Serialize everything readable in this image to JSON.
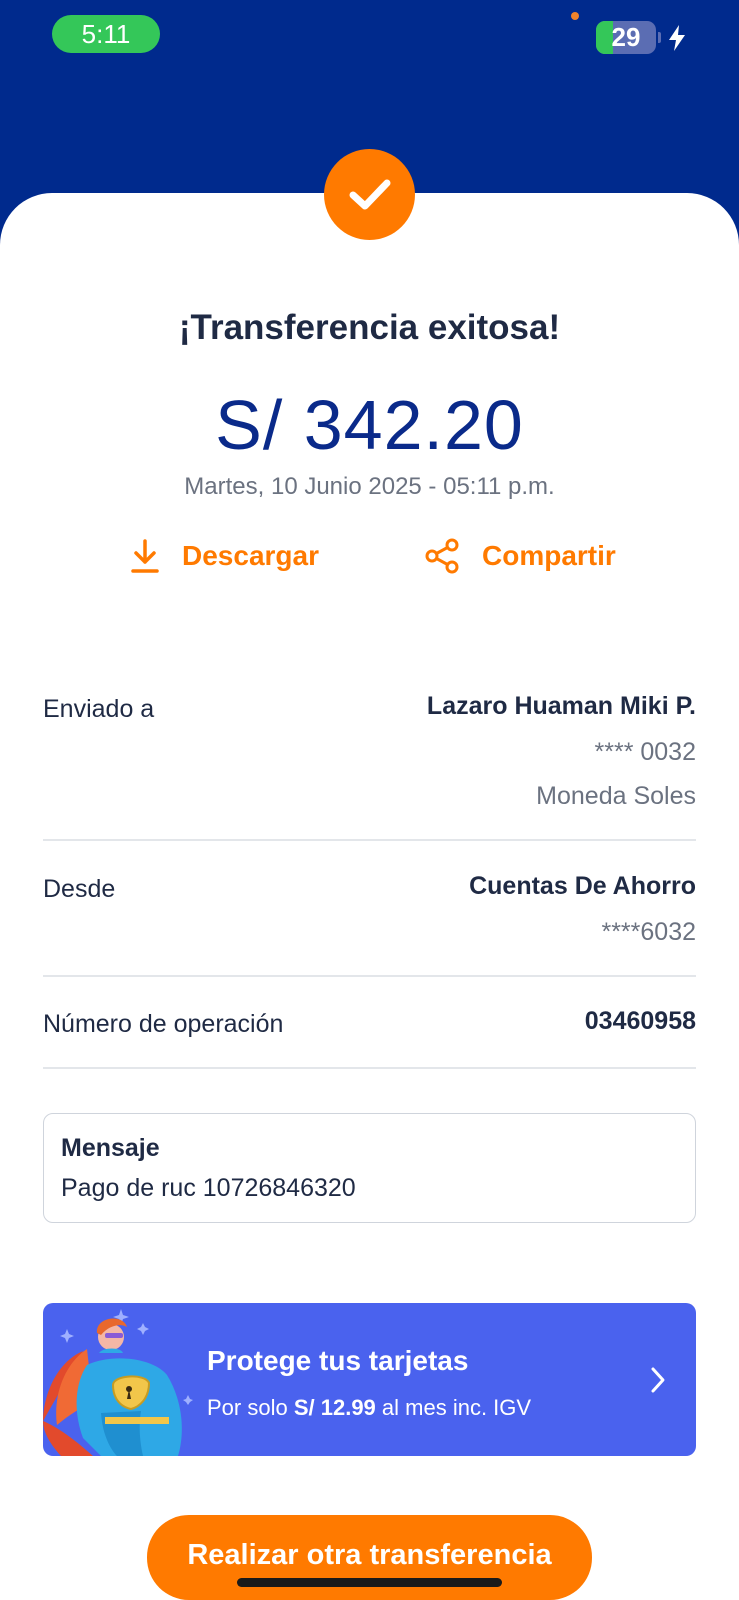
{
  "status_bar": {
    "time": "5:11",
    "battery_level": "29",
    "battery_fraction": 0.29,
    "icons": [
      "privacy-dot-icon",
      "battery-icon",
      "charging-bolt-icon"
    ]
  },
  "colors": {
    "header_blue": "#002a8d",
    "accent_orange": "#ff7a00",
    "amount_blue": "#0a2a8a",
    "promo_blue": "#4a62ee"
  },
  "success": {
    "icon": "checkmark-icon",
    "title": "¡Transferencia exitosa!",
    "amount": "S/ 342.20",
    "datetime": "Martes, 10 Junio 2025 - 05:11 p.m."
  },
  "actions": {
    "download_label": "Descargar",
    "download_icon": "download-icon",
    "share_label": "Compartir",
    "share_icon": "share-icon"
  },
  "details": {
    "sent_to": {
      "label": "Enviado a",
      "name": "Lazaro Huaman Miki P.",
      "account": "**** 0032",
      "currency": "Moneda Soles"
    },
    "from": {
      "label": "Desde",
      "account_type": "Cuentas De Ahorro",
      "account": "****6032"
    },
    "operation": {
      "label": "Número de operación",
      "number": "03460958"
    }
  },
  "message": {
    "title": "Mensaje",
    "text": "Pago de ruc 10726846320"
  },
  "promo": {
    "title": "Protege tus tarjetas",
    "sub_prefix": "Por solo",
    "sub_price": "S/ 12.99",
    "sub_suffix": "al mes inc. IGV",
    "art_icon": "superhero-illustration",
    "chevron_icon": "chevron-right-icon"
  },
  "cta": {
    "label": "Realizar otra transferencia"
  }
}
